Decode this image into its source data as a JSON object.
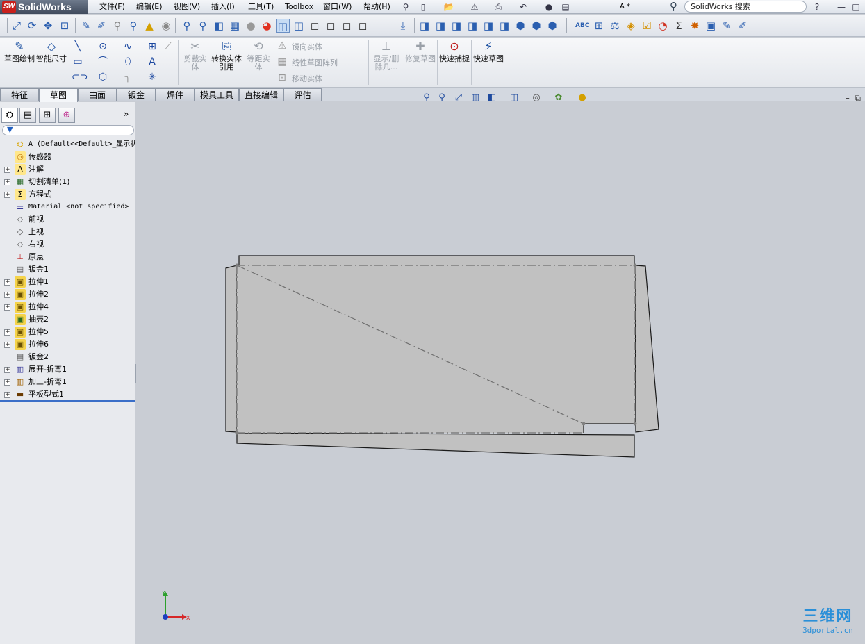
{
  "app": {
    "name": "SolidWorks",
    "badge": "SW"
  },
  "menu": [
    "文件(F)",
    "编辑(E)",
    "视图(V)",
    "插入(I)",
    "工具(T)",
    "Toolbox",
    "窗口(W)",
    "帮助(H)"
  ],
  "doc_title": "A *",
  "search": {
    "placeholder": "SolidWorks 搜索"
  },
  "help_label": "?",
  "command_manager": {
    "sketch": "草图绘制",
    "smart_dim": "智能尺寸",
    "trim": "剪裁实体",
    "convert": "转换实体引用",
    "offset": "等距实体",
    "mirror": "镜向实体",
    "linear_pattern": "线性草图阵列",
    "move": "移动实体",
    "show_delete": "显示/删除几...",
    "repair": "修复草图",
    "quick_snap": "快速捕捉",
    "rapid_sketch": "快速草图"
  },
  "tabs": [
    "特征",
    "草图",
    "曲面",
    "钣金",
    "焊件",
    "模具工具",
    "直接编辑",
    "评估"
  ],
  "active_tab": "草图",
  "tree": [
    {
      "label": "A  (Default<<Default>_显示状态",
      "icon": "part-icon",
      "expand": false
    },
    {
      "label": "传感器",
      "icon": "sensor-icon",
      "expand": false
    },
    {
      "label": "注解",
      "icon": "annotation-icon",
      "expand": true
    },
    {
      "label": "切割清单(1)",
      "icon": "cutlist-icon",
      "expand": true
    },
    {
      "label": "方程式",
      "icon": "equation-icon",
      "expand": true
    },
    {
      "label": "Material <not specified>",
      "icon": "material-icon",
      "expand": false
    },
    {
      "label": "前视",
      "icon": "plane-icon",
      "expand": false
    },
    {
      "label": "上视",
      "icon": "plane-icon",
      "expand": false
    },
    {
      "label": "右视",
      "icon": "plane-icon",
      "expand": false
    },
    {
      "label": "原点",
      "icon": "origin-icon",
      "expand": false
    },
    {
      "label": "钣金1",
      "icon": "sheetmetal-icon",
      "expand": false
    },
    {
      "label": "拉伸1",
      "icon": "extrude-icon",
      "expand": true
    },
    {
      "label": "拉伸2",
      "icon": "extrude-icon",
      "expand": true
    },
    {
      "label": "拉伸4",
      "icon": "extrude-icon",
      "expand": true
    },
    {
      "label": "抽壳2",
      "icon": "shell-icon",
      "expand": false
    },
    {
      "label": "拉伸5",
      "icon": "extrude-icon",
      "expand": true
    },
    {
      "label": "拉伸6",
      "icon": "extrude-icon",
      "expand": true
    },
    {
      "label": "钣金2",
      "icon": "sheetmetal-icon",
      "expand": false
    },
    {
      "label": "展开-折弯1",
      "icon": "unfold-icon",
      "expand": true
    },
    {
      "label": "加工-折弯1",
      "icon": "process-bend-icon",
      "expand": true
    },
    {
      "label": "平板型式1",
      "icon": "flat-pattern-icon",
      "expand": true
    }
  ],
  "triad": {
    "y": "Y",
    "x": "X"
  },
  "watermark": {
    "big": "三维网",
    "small": "3dportal.cn"
  }
}
